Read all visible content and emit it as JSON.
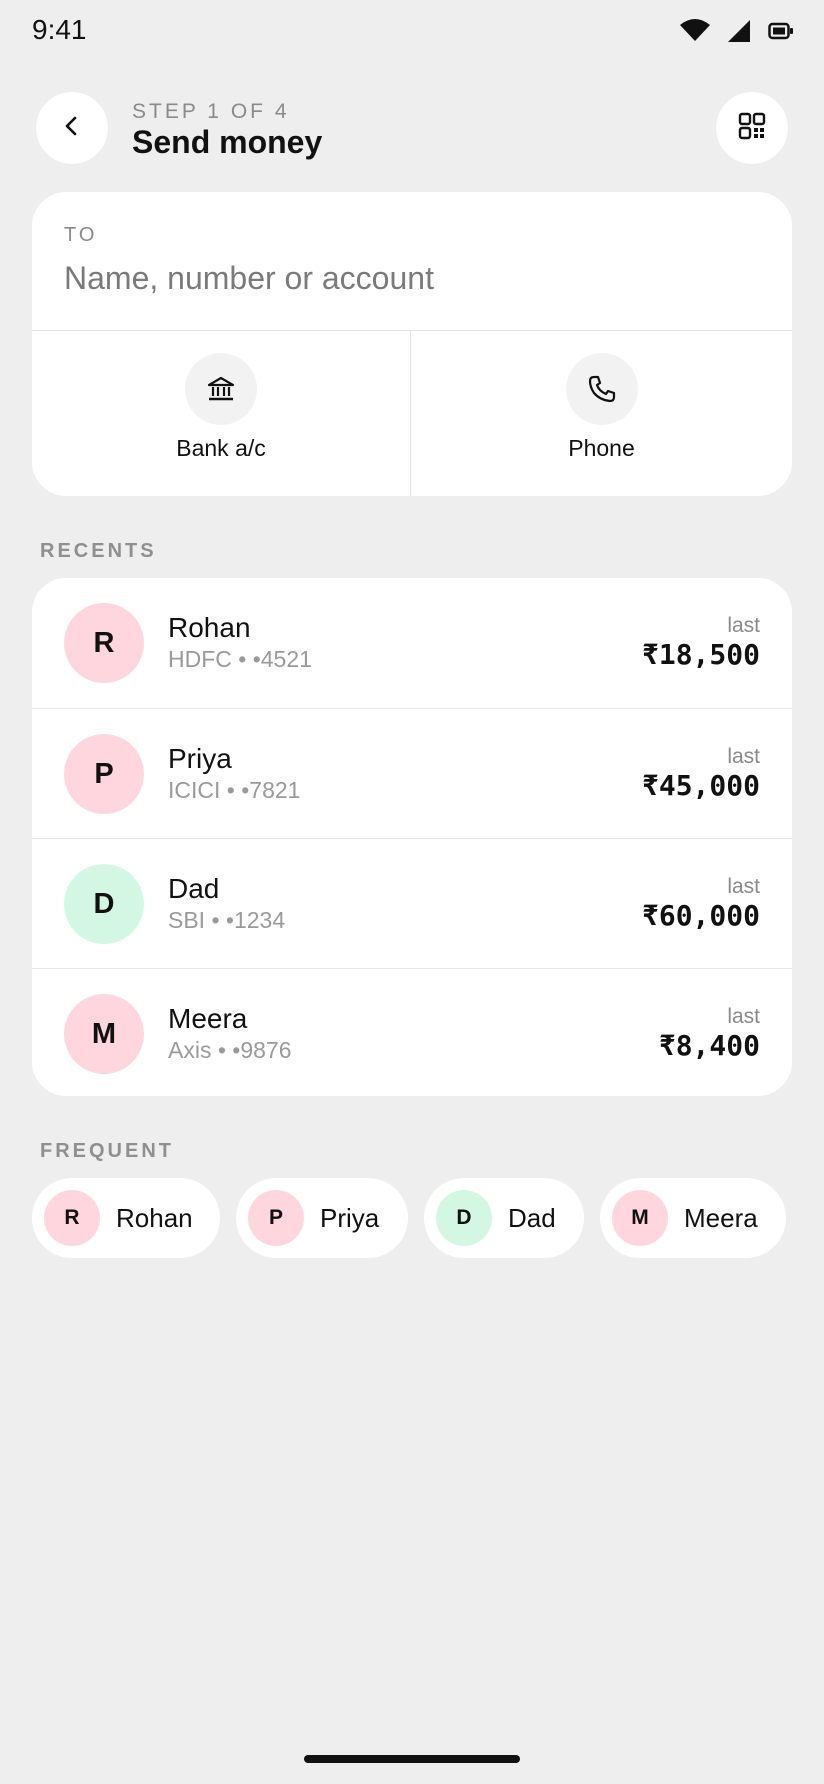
{
  "status_bar": {
    "time": "9:41",
    "icons": [
      "wifi-icon",
      "signal-icon",
      "battery-icon"
    ]
  },
  "header": {
    "step": "STEP 1 OF 4",
    "title": "Send money",
    "back_icon": "chevron-left-icon",
    "qr_icon": "qr-code-icon"
  },
  "to_card": {
    "label": "TO",
    "placeholder": "Name, number or account",
    "value": "",
    "methods": [
      {
        "label": "Bank a/c",
        "icon": "bank-icon"
      },
      {
        "label": "Phone",
        "icon": "phone-icon"
      }
    ]
  },
  "recents": {
    "label": "RECENTS",
    "items": [
      {
        "initial": "R",
        "name": "Rohan",
        "sub": "HDFC • •4521",
        "last_label": "last",
        "amount": "₹18,500",
        "avatar_color": "#ffd6de"
      },
      {
        "initial": "P",
        "name": "Priya",
        "sub": "ICICI • •7821",
        "last_label": "last",
        "amount": "₹45,000",
        "avatar_color": "#ffd6de"
      },
      {
        "initial": "D",
        "name": "Dad",
        "sub": "SBI • •1234",
        "last_label": "last",
        "amount": "₹60,000",
        "avatar_color": "#d4f7e4"
      },
      {
        "initial": "M",
        "name": "Meera",
        "sub": "Axis • •9876",
        "last_label": "last",
        "amount": "₹8,400",
        "avatar_color": "#ffd6de"
      }
    ]
  },
  "frequent": {
    "label": "FREQUENT",
    "items": [
      {
        "initial": "R",
        "name": "Rohan",
        "avatar_color": "#ffd6de"
      },
      {
        "initial": "P",
        "name": "Priya",
        "avatar_color": "#ffd6de"
      },
      {
        "initial": "D",
        "name": "Dad",
        "avatar_color": "#d4f7e4"
      },
      {
        "initial": "M",
        "name": "Meera",
        "avatar_color": "#ffd6de"
      }
    ]
  },
  "colors": {
    "background": "#eeeeee",
    "card": "#ffffff",
    "text": "#111111",
    "muted": "#8a8a8a"
  }
}
